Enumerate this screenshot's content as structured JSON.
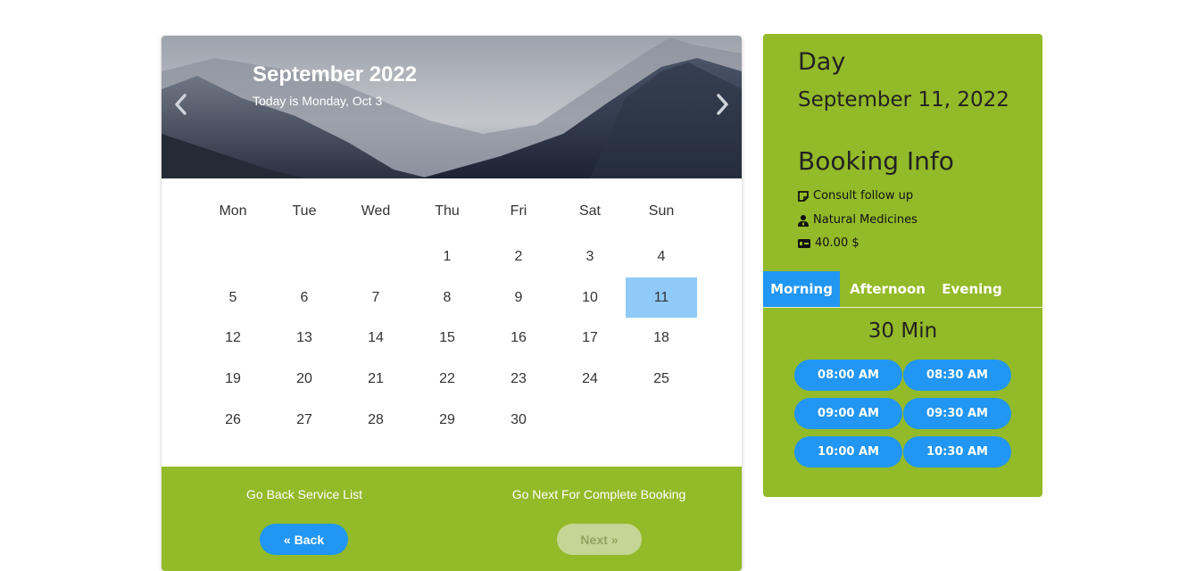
{
  "calendar": {
    "month_title": "September 2022",
    "today_text": "Today is Monday, Oct 3",
    "weekdays": [
      "Mon",
      "Tue",
      "Wed",
      "Thu",
      "Fri",
      "Sat",
      "Sun"
    ],
    "days": [
      "",
      "",
      "",
      "1",
      "2",
      "3",
      "4",
      "5",
      "6",
      "7",
      "8",
      "9",
      "10",
      "11",
      "12",
      "13",
      "14",
      "15",
      "16",
      "17",
      "18",
      "19",
      "20",
      "21",
      "22",
      "23",
      "24",
      "25",
      "26",
      "27",
      "28",
      "29",
      "30",
      "",
      ""
    ],
    "selected_day": "11",
    "selected_color": "#90caf9"
  },
  "footer": {
    "back_text": "Go Back Service List",
    "next_text": "Go Next For Complete Booking",
    "back_button": "Back",
    "next_button": "Next",
    "back_icon": "double-chevron-left-icon",
    "next_icon": "double-chevron-right-icon",
    "next_disabled": true,
    "background": "#93ba28"
  },
  "booking": {
    "day_heading": "Day",
    "date": "September 11, 2022",
    "title": "Booking Info",
    "items": [
      {
        "icon": "note-icon",
        "text": "Consult follow up"
      },
      {
        "icon": "doctor-icon",
        "text": "Natural Medicines"
      },
      {
        "icon": "money-icon",
        "text": "40.00 $"
      }
    ],
    "tabs": [
      {
        "label": "Morning",
        "active": true
      },
      {
        "label": "Afternoon",
        "active": false
      },
      {
        "label": "Evening",
        "active": false
      }
    ],
    "duration": "30 Min",
    "slots": [
      "08:00 AM",
      "08:30 AM",
      "09:00 AM",
      "09:30 AM",
      "10:00 AM",
      "10:30 AM"
    ],
    "accent": "#2196f3",
    "background": "#93ba28"
  }
}
